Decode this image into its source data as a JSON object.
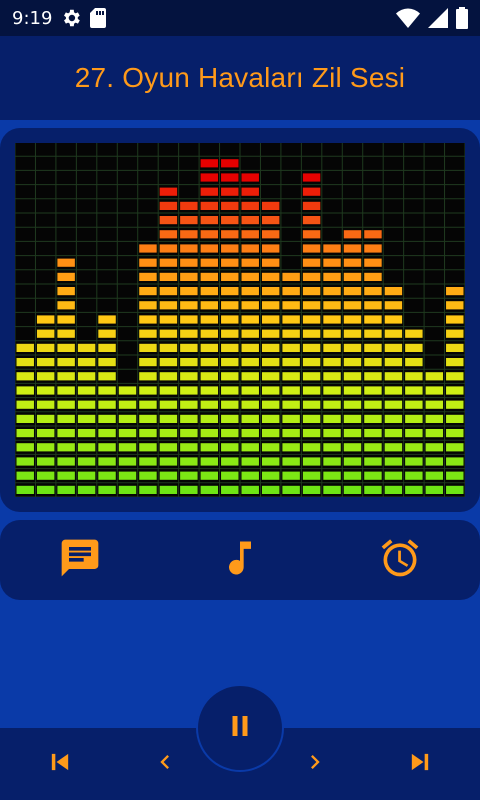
{
  "status_bar": {
    "time": "9:19",
    "icons": [
      "settings-gear-icon",
      "sd-card-icon",
      "wifi-icon",
      "cell-signal-icon",
      "battery-icon"
    ]
  },
  "header": {
    "title": "27. Oyun Havaları Zil Sesi"
  },
  "visualizer": {
    "levels": [
      0.47,
      0.56,
      0.72,
      0.47,
      0.56,
      0.35,
      0.75,
      0.91,
      0.87,
      0.98,
      0.98,
      0.94,
      0.86,
      0.67,
      0.94,
      0.76,
      0.8,
      0.79,
      0.61,
      0.52,
      0.39,
      0.61
    ]
  },
  "actions": [
    {
      "name": "message-icon"
    },
    {
      "name": "music-note-icon"
    },
    {
      "name": "alarm-clock-icon"
    }
  ],
  "controls": {
    "play_state": "playing",
    "icons": [
      "skip-previous-icon",
      "chevron-left-icon",
      "pause-icon",
      "chevron-right-icon",
      "skip-next-icon"
    ]
  },
  "colors": {
    "accent": "#ff9a1a",
    "background": "#0a3aa8",
    "panel": "#061f6a"
  }
}
